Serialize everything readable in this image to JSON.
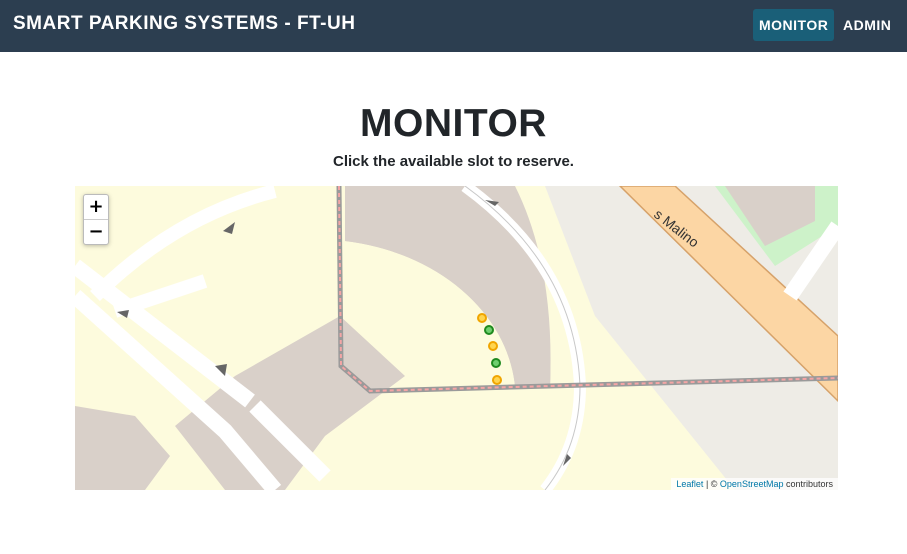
{
  "navbar": {
    "brand": "SMART PARKING SYSTEMS - FT-UH",
    "links": [
      {
        "label": "MONITOR",
        "active": true
      },
      {
        "label": "ADMIN",
        "active": false
      }
    ]
  },
  "main": {
    "title": "MONITOR",
    "subtitle": "Click the available slot to reserve."
  },
  "map": {
    "zoom_in_label": "+",
    "zoom_out_label": "−",
    "street_label": "s Malino",
    "attribution": {
      "leaflet": "Leaflet",
      "separator": " | © ",
      "osm": "OpenStreetMap",
      "suffix": " contributors"
    },
    "slots": [
      {
        "status": "reserved",
        "color": "#f0a500"
      },
      {
        "status": "available",
        "color": "#1f8a1f"
      },
      {
        "status": "reserved",
        "color": "#f0a500"
      },
      {
        "status": "available",
        "color": "#1f8a1f"
      },
      {
        "status": "reserved",
        "color": "#f0a500"
      }
    ]
  },
  "colors": {
    "navbar": "#2c3e50",
    "active_link": "#1a5f78",
    "road_main": "#fcd6a4",
    "land": "#fdfbdd",
    "building": "#d9d0c9"
  }
}
